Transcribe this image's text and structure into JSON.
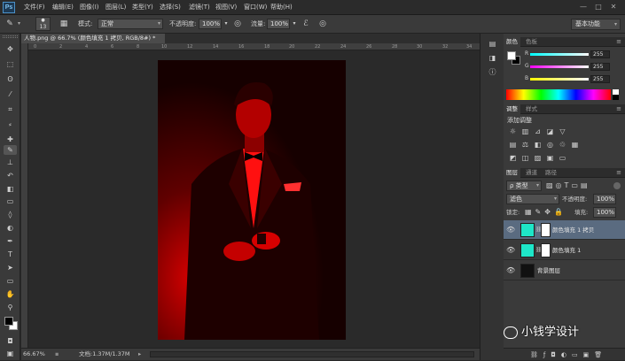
{
  "app": {
    "logo": "Ps"
  },
  "menu": [
    "文件(F)",
    "编辑(E)",
    "图像(I)",
    "图层(L)",
    "类型(Y)",
    "选择(S)",
    "滤镜(T)",
    "视图(V)",
    "窗口(W)",
    "帮助(H)"
  ],
  "window_controls": [
    "—",
    "□",
    "✕"
  ],
  "options": {
    "brush_size": "13",
    "mode_label": "模式:",
    "mode_value": "正常",
    "opacity_label": "不透明度:",
    "opacity_value": "100%",
    "flow_label": "流量:",
    "flow_value": "100%",
    "workspace": "基本功能"
  },
  "document": {
    "tab_title": "人物.png @ 66.7% (颜色填充 1 拷贝, RGB/8#) *",
    "ruler_ticks": [
      "0",
      "2",
      "4",
      "6",
      "8",
      "10",
      "12",
      "14",
      "16",
      "18",
      "20",
      "22",
      "24",
      "26",
      "28",
      "30",
      "32",
      "34"
    ],
    "zoom": "66.67%",
    "doc_info": "文档:1.37M/1.37M"
  },
  "panels": {
    "color_tabs": [
      "颜色",
      "色板"
    ],
    "color": {
      "r_label": "R",
      "g_label": "G",
      "b_label": "B",
      "r": "255",
      "g": "255",
      "b": "255"
    },
    "adjust_tabs": [
      "调整",
      "样式"
    ],
    "adjust_title": "添加调整",
    "layers_tabs": [
      "图层",
      "通道",
      "路径"
    ],
    "kind": "ρ 类型",
    "blend": "滤色",
    "opacity_label": "不透明度:",
    "opacity_value": "100%",
    "lock_label": "锁定:",
    "fill_label": "填充:",
    "fill_value": "100%",
    "layers": [
      {
        "name": "颜色填充 1 拷贝",
        "selected": true
      },
      {
        "name": "颜色填充 1",
        "selected": false
      },
      {
        "name": "背景图层",
        "selected": false
      }
    ]
  },
  "watermark": "小钱学设计",
  "colors": {
    "accent": "#5a6b80",
    "fill_layer": "#1ee6c8",
    "photo_red": "#e00000"
  }
}
